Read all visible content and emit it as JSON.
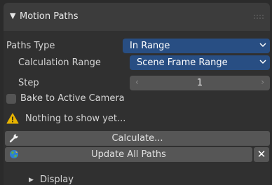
{
  "panel": {
    "title": "Motion Paths",
    "collapse_glyph": "▼"
  },
  "paths_type": {
    "label": "Paths Type",
    "value": "In Range"
  },
  "calculation_range": {
    "label": "Calculation Range",
    "value": "Scene Frame Range"
  },
  "step": {
    "label": "Step",
    "value": "1"
  },
  "bake": {
    "label": "Bake to Active Camera",
    "checked": false
  },
  "message": {
    "text": "Nothing to show yet...",
    "icon": "warning-icon"
  },
  "actions": {
    "calculate_label": "Calculate...",
    "calculate_icon": "wrench-icon",
    "update_label": "Update All Paths",
    "update_icon": "globe-icon",
    "close_glyph": "✕"
  },
  "display": {
    "label": "Display",
    "glyph": "▶"
  },
  "colors": {
    "panel_bg": "#303030",
    "header_bg": "#3c3c3c",
    "dropdown_bg": "#284e83",
    "button_bg": "#565656",
    "warning": "#e8b400"
  }
}
